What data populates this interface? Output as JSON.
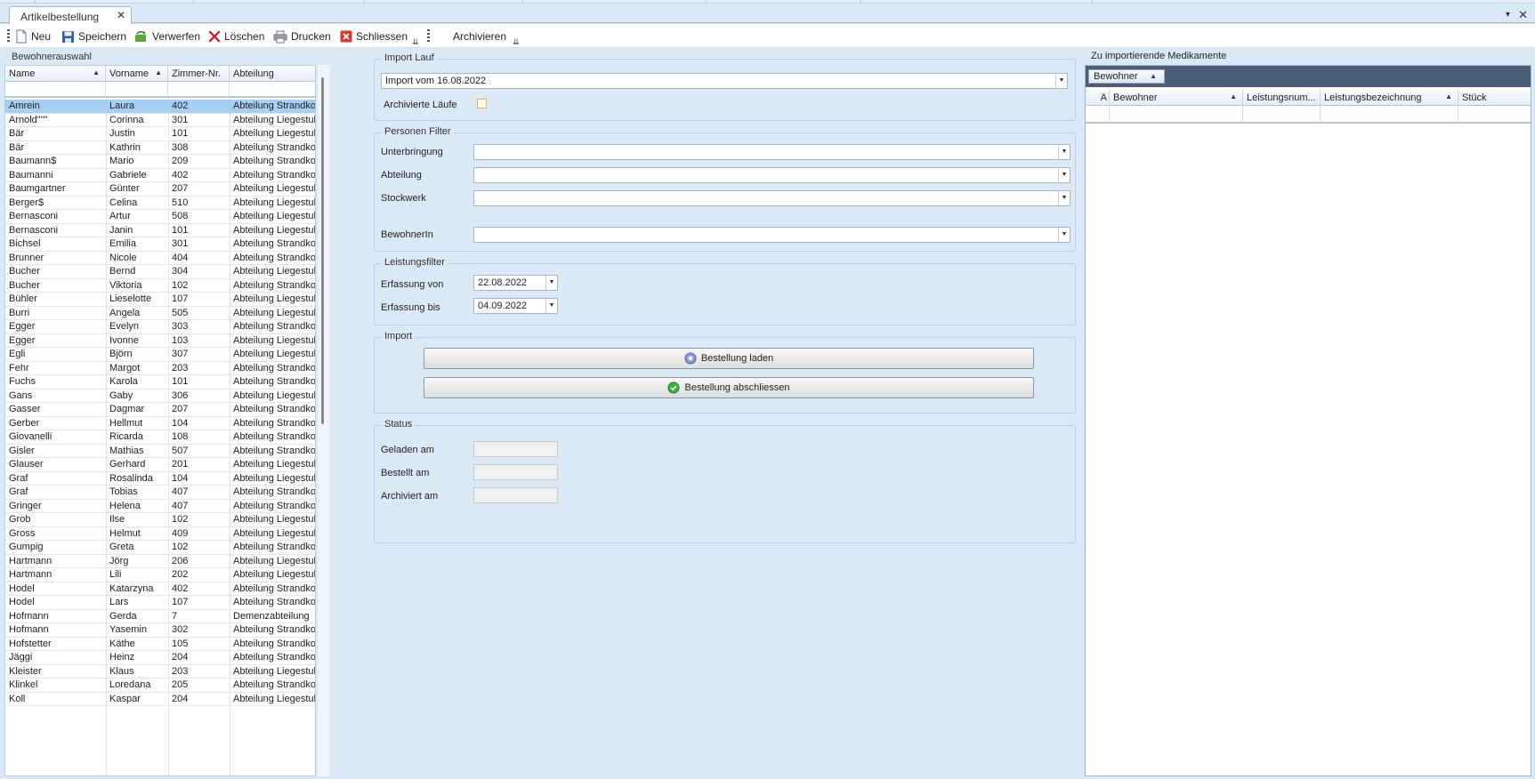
{
  "window": {
    "tab_title": "Artikelbestellung",
    "tab_close": "✕",
    "menu_glyph": "▾",
    "close_glyph": "✕"
  },
  "toolbar": {
    "new_label": "Neu",
    "save_label": "Speichern",
    "discard_label": "Verwerfen",
    "delete_label": "Löschen",
    "print_label": "Drucken",
    "close_label": "Schliessen",
    "archive_label": "Archivieren",
    "overflow_glyph": "⇊"
  },
  "residents": {
    "title": "Bewohnerauswahl",
    "columns": [
      "Name",
      "Vorname",
      "Zimmer-Nr.",
      "Abteilung"
    ],
    "rows": [
      [
        "Amrein",
        "Laura",
        "402",
        "Abteilung Strandkorb"
      ],
      [
        "Arnold\"\"\"",
        "Corinna",
        "301",
        "Abteilung Liegestuhl"
      ],
      [
        "Bär",
        "Justin",
        "101",
        "Abteilung Liegestuhl"
      ],
      [
        "Bär",
        "Kathrin",
        "308",
        "Abteilung Strandkorb"
      ],
      [
        "Baumann$",
        "Mario",
        "209",
        "Abteilung Strandkorb"
      ],
      [
        "Baumanni",
        "Gabriele",
        "402",
        "Abteilung Strandkorb"
      ],
      [
        "Baumgartner",
        "Günter",
        "207",
        "Abteilung Liegestuhl"
      ],
      [
        "Berger$",
        "Celina",
        "510",
        "Abteilung Liegestuhl"
      ],
      [
        "Bernasconi",
        "Artur",
        "508",
        "Abteilung Liegestuhl"
      ],
      [
        "Bernasconi",
        "Janin",
        "101",
        "Abteilung Liegestuhl"
      ],
      [
        "Bichsel",
        "Emilia",
        "301",
        "Abteilung Strandkorb"
      ],
      [
        "Brunner",
        "Nicole",
        "404",
        "Abteilung Strandkorb"
      ],
      [
        "Bucher",
        "Bernd",
        "304",
        "Abteilung Liegestuhl"
      ],
      [
        "Bucher",
        "Viktoria",
        "102",
        "Abteilung Strandkorb"
      ],
      [
        "Bühler",
        "Lieselotte",
        "107",
        "Abteilung Liegestuhl"
      ],
      [
        "Burri",
        "Angela",
        "505",
        "Abteilung Liegestuhl"
      ],
      [
        "Egger",
        "Evelyn",
        "303",
        "Abteilung Strandkorb"
      ],
      [
        "Egger",
        "Ivonne",
        "103",
        "Abteilung Liegestuhl"
      ],
      [
        "Egli",
        "Björn",
        "307",
        "Abteilung Liegestuhl"
      ],
      [
        "Fehr",
        "Margot",
        "203",
        "Abteilung Strandkorb"
      ],
      [
        "Fuchs",
        "Karola",
        "101",
        "Abteilung Strandkorb"
      ],
      [
        "Gans",
        "Gaby",
        "306",
        "Abteilung Liegestuhl"
      ],
      [
        "Gasser",
        "Dagmar",
        "207",
        "Abteilung Strandkorb"
      ],
      [
        "Gerber",
        "Hellmut",
        "104",
        "Abteilung Strandkorb"
      ],
      [
        "Giovanelli",
        "Ricarda",
        "108",
        "Abteilung Strandkorb"
      ],
      [
        "Gisler",
        "Mathias",
        "507",
        "Abteilung Strandkorb"
      ],
      [
        "Glauser",
        "Gerhard",
        "201",
        "Abteilung Liegestuhl"
      ],
      [
        "Graf",
        "Rosalinda",
        "104",
        "Abteilung Liegestuhl"
      ],
      [
        "Graf",
        "Tobias",
        "407",
        "Abteilung Strandkorb"
      ],
      [
        "Gringer",
        "Helena",
        "407",
        "Abteilung Strandkorb"
      ],
      [
        "Grob",
        "Ilse",
        "102",
        "Abteilung Liegestuhl"
      ],
      [
        "Gross",
        "Helmut",
        "409",
        "Abteilung Liegestuhl"
      ],
      [
        "Gumpig",
        "Greta",
        "102",
        "Abteilung Strandkorb"
      ],
      [
        "Hartmann",
        "Jörg",
        "206",
        "Abteilung Liegestuhl"
      ],
      [
        "Hartmann",
        "Lili",
        "202",
        "Abteilung Liegestuhl"
      ],
      [
        "Hodel",
        "Katarzyna",
        "402",
        "Abteilung Strandkorb"
      ],
      [
        "Hodel",
        "Lars",
        "107",
        "Abteilung Strandkorb"
      ],
      [
        "Hofmann",
        "Gerda",
        "7",
        "Demenzabteilung"
      ],
      [
        "Hofmann",
        "Yasemin",
        "302",
        "Abteilung Strandkorb"
      ],
      [
        "Hofstetter",
        "Käthe",
        "105",
        "Abteilung Strandkorb"
      ],
      [
        "Jäggi",
        "Heinz",
        "204",
        "Abteilung Strandkorb"
      ],
      [
        "Kleister",
        "Klaus",
        "203",
        "Abteilung Liegestuhl"
      ],
      [
        "Klinkel",
        "Loredana",
        "205",
        "Abteilung Strandkorb"
      ],
      [
        "Koll",
        "Kaspar",
        "204",
        "Abteilung Liegestuhl"
      ]
    ]
  },
  "import_run": {
    "title": "Import Lauf",
    "selected": "Import vom 16.08.2022",
    "archived_label": "Archivierte Läufe"
  },
  "person_filter": {
    "title": "Personen Filter",
    "housing_label": "Unterbringung",
    "department_label": "Abteilung",
    "floor_label": "Stockwerk",
    "resident_label": "BewohnerIn"
  },
  "service_filter": {
    "title": "Leistungsfilter",
    "from_label": "Erfassung von",
    "from_value": "22.08.2022",
    "to_label": "Erfassung bis",
    "to_value": "04.09.2022"
  },
  "import": {
    "title": "Import",
    "load_label": "Bestellung laden",
    "complete_label": "Bestellung abschliessen"
  },
  "status": {
    "title": "Status",
    "loaded_label": "Geladen am",
    "ordered_label": "Bestellt am",
    "archived_label": "Archiviert am"
  },
  "medications": {
    "title": "Zu importierende Medikamente",
    "group_chip": "Bewohner",
    "columns": [
      "A",
      "Bewohner",
      "Leistungsnum...",
      "Leistungsbezeichnung",
      "Stück"
    ]
  },
  "colors": {
    "background": "#dbe8f6",
    "selection": "#a6cff3",
    "groupbar": "#4b5e78"
  }
}
